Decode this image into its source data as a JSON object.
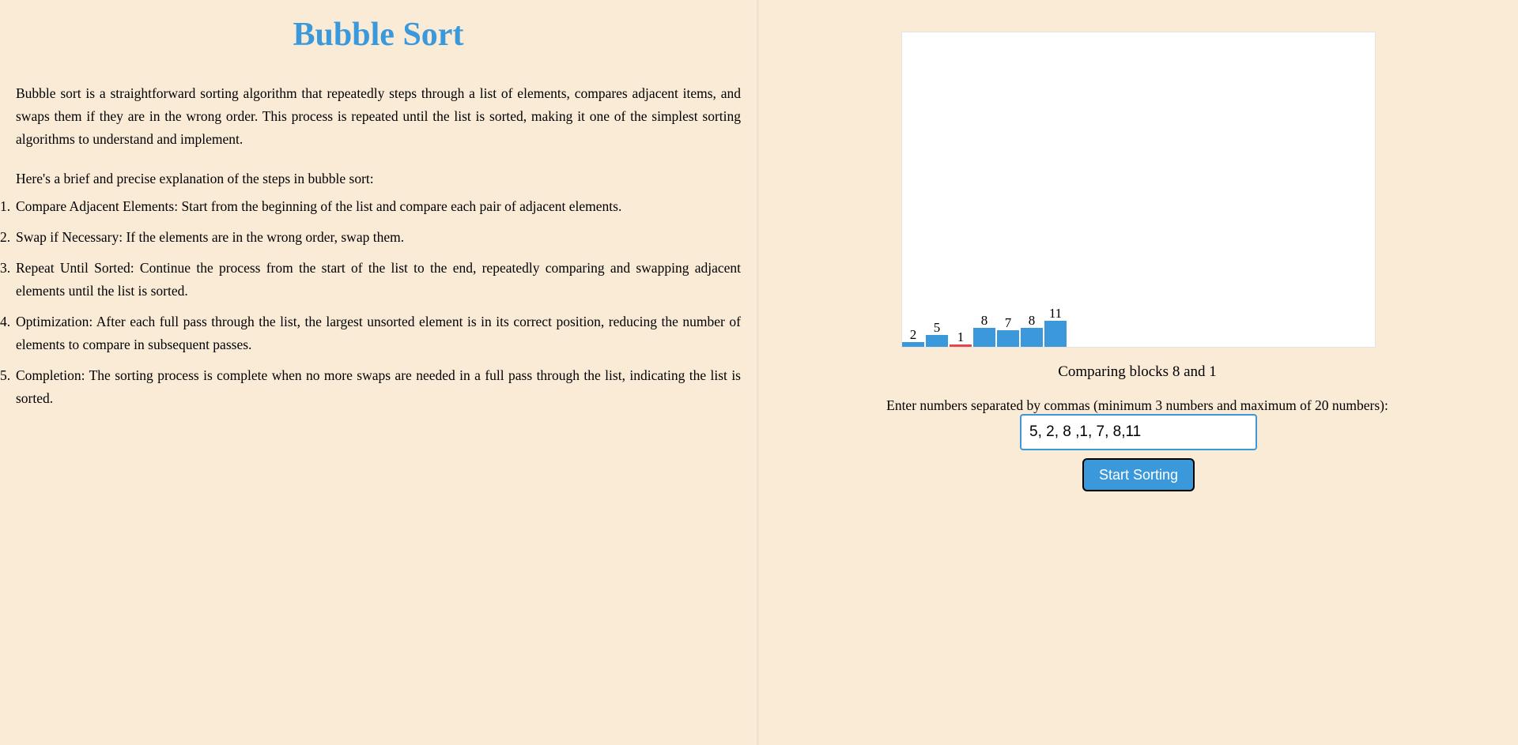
{
  "left": {
    "title": "Bubble Sort",
    "description": "Bubble sort is a straightforward sorting algorithm that repeatedly steps through a list of elements, compares adjacent items, and swaps them if they are in the wrong order. This process is repeated until the list is sorted, making it one of the simplest sorting algorithms to understand and implement.",
    "intro": "Here's a brief and precise explanation of the steps in bubble sort:",
    "steps": [
      {
        "num": "1.",
        "text": "Compare Adjacent Elements: Start from the beginning of the list and compare each pair of adjacent elements."
      },
      {
        "num": "2.",
        "text": "Swap if Necessary: If the elements are in the wrong order, swap them."
      },
      {
        "num": "3.",
        "text": "Repeat Until Sorted: Continue the process from the start of the list to the end, repeatedly comparing and swapping adjacent elements until the list is sorted."
      },
      {
        "num": "4.",
        "text": "Optimization: After each full pass through the list, the largest unsorted element is in its correct position, reducing the number of elements to compare in subsequent passes."
      },
      {
        "num": "5.",
        "text": "Completion: The sorting process is complete when no more swaps are needed in a full pass through the list, indicating the list is sorted."
      }
    ]
  },
  "chart_data": {
    "type": "bar",
    "categories": [
      "2",
      "5",
      "1",
      "8",
      "7",
      "8",
      "11"
    ],
    "values": [
      2,
      5,
      1,
      8,
      7,
      8,
      11
    ],
    "highlight_index": 2,
    "bar_color": "#3a98db",
    "highlight_color": "#e84545"
  },
  "right": {
    "status": "Comparing blocks 8 and 1",
    "prompt": "Enter numbers separated by commas (minimum 3 numbers and maximum of 20 numbers):",
    "input_value": "5, 2, 8 ,1, 7, 8,11",
    "button_label": "Start Sorting"
  }
}
